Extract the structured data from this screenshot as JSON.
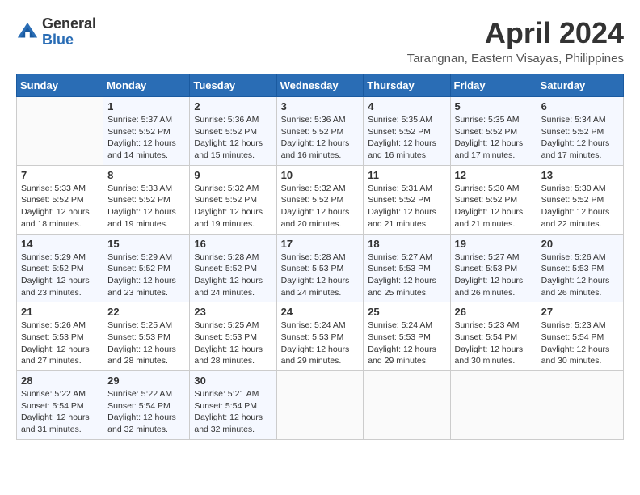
{
  "header": {
    "logo_general": "General",
    "logo_blue": "Blue",
    "month_year": "April 2024",
    "location": "Tarangnan, Eastern Visayas, Philippines"
  },
  "days_of_week": [
    "Sunday",
    "Monday",
    "Tuesday",
    "Wednesday",
    "Thursday",
    "Friday",
    "Saturday"
  ],
  "weeks": [
    [
      {
        "day": "",
        "info": ""
      },
      {
        "day": "1",
        "info": "Sunrise: 5:37 AM\nSunset: 5:52 PM\nDaylight: 12 hours and 14 minutes."
      },
      {
        "day": "2",
        "info": "Sunrise: 5:36 AM\nSunset: 5:52 PM\nDaylight: 12 hours and 15 minutes."
      },
      {
        "day": "3",
        "info": "Sunrise: 5:36 AM\nSunset: 5:52 PM\nDaylight: 12 hours and 16 minutes."
      },
      {
        "day": "4",
        "info": "Sunrise: 5:35 AM\nSunset: 5:52 PM\nDaylight: 12 hours and 16 minutes."
      },
      {
        "day": "5",
        "info": "Sunrise: 5:35 AM\nSunset: 5:52 PM\nDaylight: 12 hours and 17 minutes."
      },
      {
        "day": "6",
        "info": "Sunrise: 5:34 AM\nSunset: 5:52 PM\nDaylight: 12 hours and 17 minutes."
      }
    ],
    [
      {
        "day": "7",
        "info": "Sunrise: 5:33 AM\nSunset: 5:52 PM\nDaylight: 12 hours and 18 minutes."
      },
      {
        "day": "8",
        "info": "Sunrise: 5:33 AM\nSunset: 5:52 PM\nDaylight: 12 hours and 19 minutes."
      },
      {
        "day": "9",
        "info": "Sunrise: 5:32 AM\nSunset: 5:52 PM\nDaylight: 12 hours and 19 minutes."
      },
      {
        "day": "10",
        "info": "Sunrise: 5:32 AM\nSunset: 5:52 PM\nDaylight: 12 hours and 20 minutes."
      },
      {
        "day": "11",
        "info": "Sunrise: 5:31 AM\nSunset: 5:52 PM\nDaylight: 12 hours and 21 minutes."
      },
      {
        "day": "12",
        "info": "Sunrise: 5:30 AM\nSunset: 5:52 PM\nDaylight: 12 hours and 21 minutes."
      },
      {
        "day": "13",
        "info": "Sunrise: 5:30 AM\nSunset: 5:52 PM\nDaylight: 12 hours and 22 minutes."
      }
    ],
    [
      {
        "day": "14",
        "info": "Sunrise: 5:29 AM\nSunset: 5:52 PM\nDaylight: 12 hours and 23 minutes."
      },
      {
        "day": "15",
        "info": "Sunrise: 5:29 AM\nSunset: 5:52 PM\nDaylight: 12 hours and 23 minutes."
      },
      {
        "day": "16",
        "info": "Sunrise: 5:28 AM\nSunset: 5:52 PM\nDaylight: 12 hours and 24 minutes."
      },
      {
        "day": "17",
        "info": "Sunrise: 5:28 AM\nSunset: 5:53 PM\nDaylight: 12 hours and 24 minutes."
      },
      {
        "day": "18",
        "info": "Sunrise: 5:27 AM\nSunset: 5:53 PM\nDaylight: 12 hours and 25 minutes."
      },
      {
        "day": "19",
        "info": "Sunrise: 5:27 AM\nSunset: 5:53 PM\nDaylight: 12 hours and 26 minutes."
      },
      {
        "day": "20",
        "info": "Sunrise: 5:26 AM\nSunset: 5:53 PM\nDaylight: 12 hours and 26 minutes."
      }
    ],
    [
      {
        "day": "21",
        "info": "Sunrise: 5:26 AM\nSunset: 5:53 PM\nDaylight: 12 hours and 27 minutes."
      },
      {
        "day": "22",
        "info": "Sunrise: 5:25 AM\nSunset: 5:53 PM\nDaylight: 12 hours and 28 minutes."
      },
      {
        "day": "23",
        "info": "Sunrise: 5:25 AM\nSunset: 5:53 PM\nDaylight: 12 hours and 28 minutes."
      },
      {
        "day": "24",
        "info": "Sunrise: 5:24 AM\nSunset: 5:53 PM\nDaylight: 12 hours and 29 minutes."
      },
      {
        "day": "25",
        "info": "Sunrise: 5:24 AM\nSunset: 5:53 PM\nDaylight: 12 hours and 29 minutes."
      },
      {
        "day": "26",
        "info": "Sunrise: 5:23 AM\nSunset: 5:54 PM\nDaylight: 12 hours and 30 minutes."
      },
      {
        "day": "27",
        "info": "Sunrise: 5:23 AM\nSunset: 5:54 PM\nDaylight: 12 hours and 30 minutes."
      }
    ],
    [
      {
        "day": "28",
        "info": "Sunrise: 5:22 AM\nSunset: 5:54 PM\nDaylight: 12 hours and 31 minutes."
      },
      {
        "day": "29",
        "info": "Sunrise: 5:22 AM\nSunset: 5:54 PM\nDaylight: 12 hours and 32 minutes."
      },
      {
        "day": "30",
        "info": "Sunrise: 5:21 AM\nSunset: 5:54 PM\nDaylight: 12 hours and 32 minutes."
      },
      {
        "day": "",
        "info": ""
      },
      {
        "day": "",
        "info": ""
      },
      {
        "day": "",
        "info": ""
      },
      {
        "day": "",
        "info": ""
      }
    ]
  ]
}
